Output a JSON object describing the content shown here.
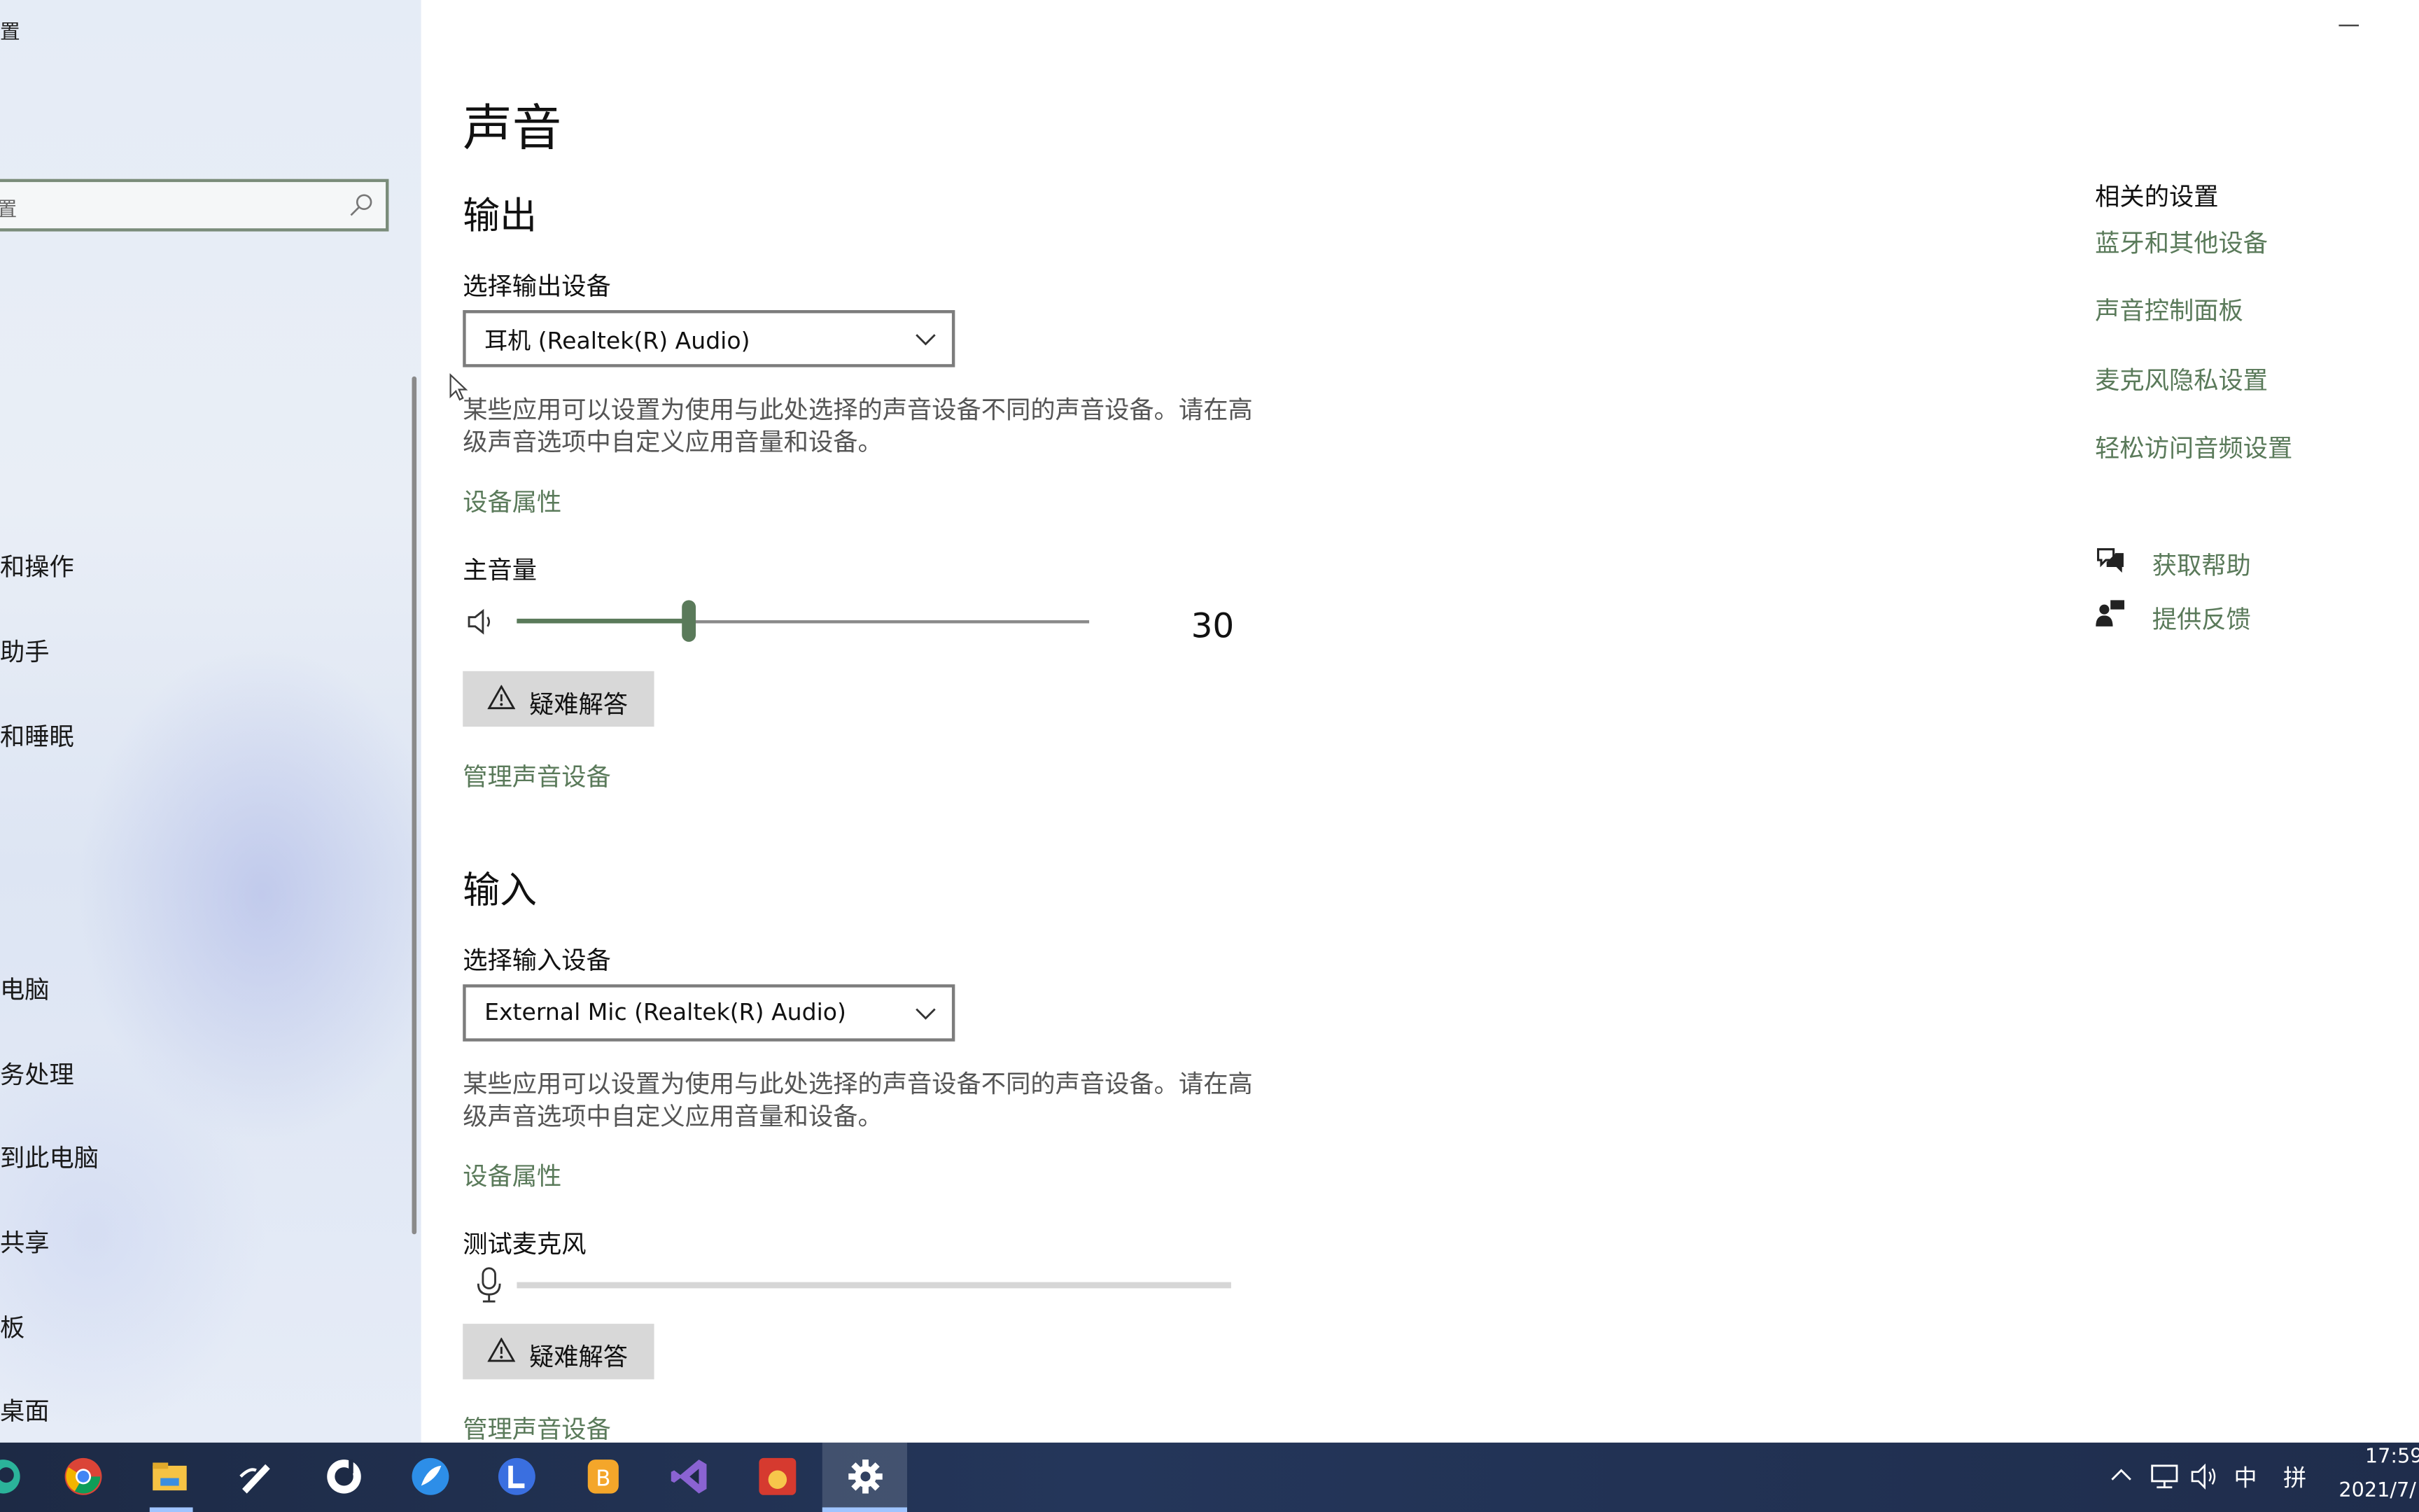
{
  "window": {
    "title_fragment": "置"
  },
  "sidebar": {
    "search_placeholder": "置",
    "items": [
      {
        "label": "和操作"
      },
      {
        "label": "助手"
      },
      {
        "label": "和睡眠"
      },
      {
        "label": "电脑"
      },
      {
        "label": "务处理"
      },
      {
        "label": "到此电脑"
      },
      {
        "label": "共享"
      },
      {
        "label": "板"
      },
      {
        "label": "桌面"
      }
    ]
  },
  "page": {
    "title": "声音",
    "output": {
      "heading": "输出",
      "device_label": "选择输出设备",
      "device_value": "耳机 (Realtek(R) Audio)",
      "description": "某些应用可以设置为使用与此处选择的声音设备不同的声音设备。请在高级声音选项中自定义应用音量和设备。",
      "properties_link": "设备属性",
      "volume_label": "主音量",
      "volume_value": "30",
      "volume_fraction": 0.3,
      "troubleshoot": "疑难解答",
      "manage_link": "管理声音设备"
    },
    "input": {
      "heading": "输入",
      "device_label": "选择输入设备",
      "device_value": "External Mic (Realtek(R) Audio)",
      "description": "某些应用可以设置为使用与此处选择的声音设备不同的声音设备。请在高级声音选项中自定义应用音量和设备。",
      "properties_link": "设备属性",
      "test_label": "测试麦克风",
      "mic_level": 0,
      "troubleshoot": "疑难解答",
      "manage_link": "管理声音设备"
    }
  },
  "related": {
    "heading": "相关的设置",
    "links": [
      "蓝牙和其他设备",
      "声音控制面板",
      "麦克风隐私设置",
      "轻松访问音频设置"
    ],
    "help": "获取帮助",
    "feedback": "提供反馈"
  },
  "taskbar": {
    "apps": [
      "edge-icon",
      "chrome-icon",
      "file-explorer-icon",
      "pen-app-icon",
      "music-app-icon",
      "feather-app-icon",
      "l-app-icon",
      "b-app-icon",
      "visual-studio-icon",
      "game-app-icon",
      "settings-icon"
    ],
    "tray_ime": "中",
    "tray_layout": "拼",
    "time": "17:59",
    "date": "2021/7/"
  },
  "colors": {
    "accent": "#5a7a5a",
    "taskbar": "#1f2d4c"
  }
}
